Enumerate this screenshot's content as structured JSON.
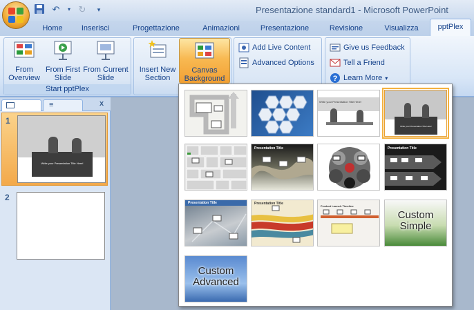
{
  "window": {
    "title": "Presentazione standard1 - Microsoft PowerPoint"
  },
  "tabs": [
    "Home",
    "Inserisci",
    "Progettazione",
    "Animazioni",
    "Presentazione",
    "Revisione",
    "Visualizza",
    "pptPlex"
  ],
  "active_tab": "pptPlex",
  "ribbon": {
    "start_group": {
      "label": "Start pptPlex",
      "from_overview": "From Overview",
      "from_first": "From First Slide",
      "from_current": "From Current Slide"
    },
    "insert_new_section": "Insert New Section",
    "canvas_background": "Canvas Background",
    "add_live_content": "Add Live Content",
    "advanced_options": "Advanced Options",
    "give_feedback": "Give us Feedback",
    "tell_friend": "Tell a Friend",
    "learn_more": "Learn More"
  },
  "slides_panel": {
    "close": "x",
    "slides": [
      {
        "number": "1",
        "caption": "Write your Presentation Title Here!"
      },
      {
        "number": "2",
        "caption": ""
      }
    ]
  },
  "gallery": {
    "thumbnails": [
      {
        "name": "arrows",
        "caption": ""
      },
      {
        "name": "hexagons",
        "caption": ""
      },
      {
        "name": "meeting-white",
        "caption": "Write your Presentation Title Here!"
      },
      {
        "name": "meeting-gray",
        "caption": "Write your Presentation Title Here!"
      },
      {
        "name": "grid-blocks",
        "caption": ""
      },
      {
        "name": "wave",
        "caption": "Presentation Title"
      },
      {
        "name": "circles-dark",
        "caption": ""
      },
      {
        "name": "chevrons-dark",
        "caption": "Presentation Title"
      },
      {
        "name": "blueprint",
        "caption": "Presentation Title"
      },
      {
        "name": "flow-ribbons",
        "caption": "Presentation Title"
      },
      {
        "name": "timeline",
        "caption": "Product Launch Timeline"
      },
      {
        "name": "custom-simple",
        "caption": "Custom Simple"
      },
      {
        "name": "custom-advanced",
        "caption": "Custom Advanced"
      }
    ]
  },
  "colors": {
    "ribbon_text": "#15428b",
    "active_button": "#f8b952",
    "selection_outline": "#f3b13f"
  }
}
